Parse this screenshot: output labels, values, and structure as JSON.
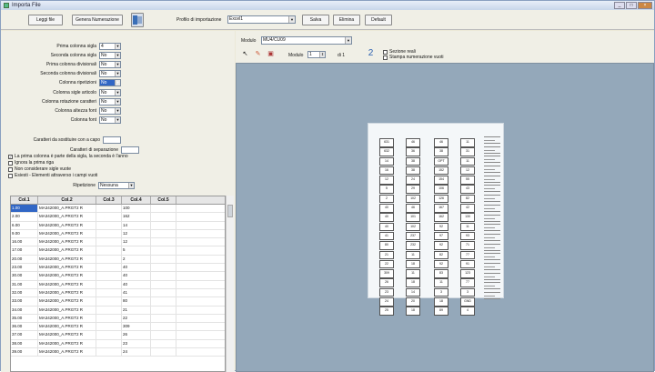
{
  "window": {
    "title": "Importa File"
  },
  "toolbar": {
    "leggi_file": "Leggi file",
    "genera_numerazione": "Genera Numerazione",
    "profilo_label": "Profilo di importazione",
    "profilo_value": "Excel1",
    "salva": "Salva",
    "elimina": "Elimina",
    "default": "Default"
  },
  "settings": {
    "rows": [
      {
        "label": "Prima colonna sigla",
        "value": "4"
      },
      {
        "label": "Seconda colonna sigla",
        "value": "No"
      },
      {
        "label": "Prima colonna divisionali",
        "value": "No"
      },
      {
        "label": "Seconda colonna divisionali",
        "value": "No"
      },
      {
        "label": "Colonna ripetizioni",
        "value": "No"
      },
      {
        "label": "Colonna sigle articolo",
        "value": "No"
      },
      {
        "label": "Colonna rotazione caratteri",
        "value": "No"
      },
      {
        "label": "Colonna altezza font",
        "value": "No"
      },
      {
        "label": "Colonna font",
        "value": "No"
      }
    ],
    "caratteri_label": "Caratteri da sostituire con a capo",
    "caratteri_value": "",
    "separazione_label": "Caratteri di separazione",
    "separazione_value": "",
    "check1": "La prima colonna è parte della sigla, la seconda è l'anno",
    "check2": "Ignora la prima riga",
    "check3": "Non considerare sigle vuote",
    "check4": "Esiesti - Elementi attraverso i campi vuoti",
    "ripetizione_label": "Ripetizione",
    "ripetizione_value": "Nessuna"
  },
  "grid": {
    "headers": [
      "Col.1",
      "Col.2",
      "Col.3",
      "Col.4",
      "Col.5"
    ],
    "rows": [
      [
        "1.00",
        "MA342000_A.PRGT2 R",
        "",
        "100",
        ""
      ],
      [
        "2.00",
        "MA342000_A.PRGT2 R",
        "",
        "162",
        ""
      ],
      [
        "6.00",
        "MA342000_A.PRGT2 R",
        "",
        "14",
        ""
      ],
      [
        "9.00",
        "MA342000_A.PRGT2 R",
        "",
        "12",
        ""
      ],
      [
        "16.00",
        "MA342000_A.PRGT2 R",
        "",
        "12",
        ""
      ],
      [
        "17.00",
        "MA342000_A.PRGT2 R",
        "",
        "5",
        ""
      ],
      [
        "20.00",
        "MA342000_A.PRGT2 R",
        "",
        "2",
        ""
      ],
      [
        "23.00",
        "MA342000_A.PRGT2 R",
        "",
        "40",
        ""
      ],
      [
        "30.00",
        "MA342000_A.PRGT2 R",
        "",
        "40",
        ""
      ],
      [
        "31.00",
        "MA342000_A.PRGT2 R",
        "",
        "40",
        ""
      ],
      [
        "32.00",
        "MA342000_A.PRGT2 R",
        "",
        "41",
        ""
      ],
      [
        "33.00",
        "MA342000_A.PRGT2 R",
        "",
        "80",
        ""
      ],
      [
        "34.00",
        "MA342000_A.PRGT2 R",
        "",
        "21",
        ""
      ],
      [
        "35.00",
        "MA342000_A.PRGT2 R",
        "",
        "22",
        ""
      ],
      [
        "36.00",
        "MA342000_A.PRGT2 R",
        "",
        "309",
        ""
      ],
      [
        "37.00",
        "MA342000_A.PRGT2 R",
        "",
        "26",
        ""
      ],
      [
        "38.00",
        "MA342000_A.PRGT2 R",
        "",
        "23",
        ""
      ],
      [
        "39.00",
        "MA342000_A.PRGT2 R",
        "",
        "24",
        ""
      ]
    ]
  },
  "preview": {
    "modulo_label": "Modulo",
    "modulo_value": "MU4/CU09",
    "pag_label": "Modulo",
    "pag_value": "1",
    "pag_of": "di 1",
    "check_sezione": "Sezione reali",
    "check_stampa": "Stampa numerazione vuoti",
    "columns": [
      [
        "631",
        "632",
        "14",
        "16",
        "12",
        "5",
        "2",
        "40",
        "40",
        "40",
        "41",
        "80",
        "21",
        "22",
        "309",
        "26",
        "23",
        "24",
        "25"
      ],
      [
        "46",
        "36",
        "38",
        "38",
        "24",
        "29",
        "102",
        "46",
        "101",
        "102",
        "237",
        "232",
        "11",
        "18",
        "11",
        "18",
        "14",
        "20",
        "18"
      ],
      [
        "46",
        "38",
        "OPT",
        "152",
        "154",
        "106",
        "126",
        "167",
        "162",
        "92",
        "97",
        "92",
        "82",
        "92",
        "83",
        "11",
        "3",
        "18",
        "89"
      ],
      [
        "11",
        "31",
        "11",
        "12",
        "55",
        "43",
        "82",
        "42",
        "130",
        "11",
        "93",
        "71",
        "77",
        "91",
        "123",
        "77",
        "3",
        "GND",
        "4"
      ]
    ]
  }
}
